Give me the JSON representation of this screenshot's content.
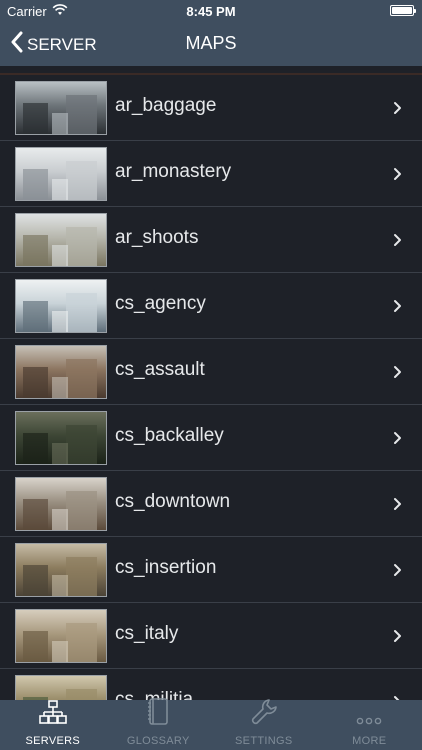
{
  "status_bar": {
    "carrier": "Carrier",
    "time": "8:45 PM"
  },
  "nav": {
    "back_label": "SERVER",
    "title": "MAPS"
  },
  "maps": [
    {
      "name": "ar_baggage",
      "thumb_colors": [
        "#2b2f33",
        "#6d7479",
        "#b9c0c4"
      ]
    },
    {
      "name": "ar_monastery",
      "thumb_colors": [
        "#8b9096",
        "#c9cdd0",
        "#e8ebec"
      ]
    },
    {
      "name": "ar_shoots",
      "thumb_colors": [
        "#7a7560",
        "#b7b7ad",
        "#dfe2e3"
      ]
    },
    {
      "name": "cs_agency",
      "thumb_colors": [
        "#5f6e7a",
        "#c9d3d8",
        "#eef1f2"
      ]
    },
    {
      "name": "cs_assault",
      "thumb_colors": [
        "#4a3a2f",
        "#8c7560",
        "#c6c0b6"
      ]
    },
    {
      "name": "cs_backalley",
      "thumb_colors": [
        "#1b2218",
        "#3d4635",
        "#6b6f5c"
      ]
    },
    {
      "name": "cs_downtown",
      "thumb_colors": [
        "#5b4a3a",
        "#9b9183",
        "#d8d3cb"
      ]
    },
    {
      "name": "cs_insertion",
      "thumb_colors": [
        "#4b4336",
        "#8d7d5f",
        "#c5bba5"
      ]
    },
    {
      "name": "cs_italy",
      "thumb_colors": [
        "#6a5a42",
        "#a99a7f",
        "#d6cdbd"
      ]
    },
    {
      "name": "cs_militia",
      "thumb_colors": [
        "#4a5a3a",
        "#9a8d6a",
        "#d0c7ad"
      ]
    }
  ],
  "tabs": [
    {
      "label": "SERVERS",
      "icon": "network-icon",
      "active": true
    },
    {
      "label": "GLOSSARY",
      "icon": "book-icon",
      "active": false
    },
    {
      "label": "SETTINGS",
      "icon": "wrench-icon",
      "active": false
    },
    {
      "label": "MORE",
      "icon": "ellipsis-icon",
      "active": false
    }
  ],
  "colors": {
    "header": "#3f4e5f",
    "background": "#1e2128",
    "active_tab": "#ffffff",
    "inactive_tab": "#7f8c98"
  }
}
